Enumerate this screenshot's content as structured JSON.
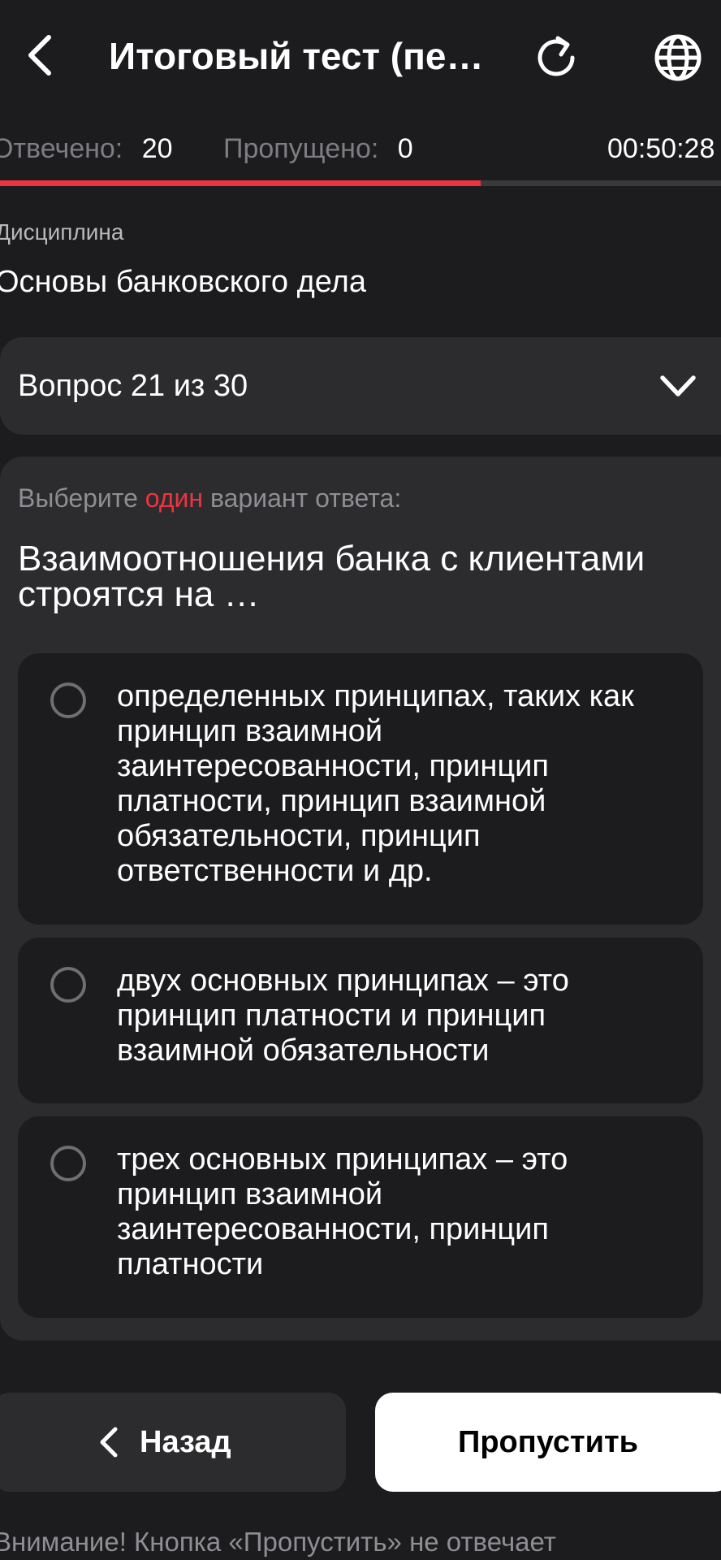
{
  "header": {
    "title": "Итоговый тест (пе…",
    "icons": {
      "back": "chevron-left-icon",
      "refresh": "refresh-icon",
      "language": "globe-icon"
    }
  },
  "stats": {
    "answered_label": "Отвечено:",
    "answered_value": "20",
    "skipped_label": "Пропущено:",
    "skipped_value": "0",
    "timer": "00:50:28"
  },
  "progress": {
    "answered": 20,
    "total": 30,
    "fill_color": "#ef3340"
  },
  "discipline": {
    "label": "Дисциплина",
    "value": "Основы банковского дела"
  },
  "question_selector": {
    "label": "Вопрос 21 из 30"
  },
  "question": {
    "instruction_prefix": "Выберите",
    "instruction_accent": "один",
    "instruction_suffix": "вариант ответа:",
    "text": "Взаимоотношения банка с клиентами строятся на …",
    "options": [
      {
        "text": "определенных принципах, таких как принцип взаимной заинтересованности, принцип платности, принцип взаимной обязательности, принцип ответственности и др.",
        "selected": false
      },
      {
        "text": "двух основных принципах – это принцип платности и принцип взаимной обязательности",
        "selected": false
      },
      {
        "text": "трех основных принципах – это принцип взаимной заинтересованности, принцип платности",
        "selected": false
      }
    ]
  },
  "footer": {
    "back_label": "Назад",
    "skip_label": "Пропустить",
    "notice": "Внимание! Кнопка «Пропустить» не отвечает"
  },
  "colors": {
    "accent": "#ef3340",
    "background": "#1c1c1e",
    "card": "#2c2c2e"
  }
}
